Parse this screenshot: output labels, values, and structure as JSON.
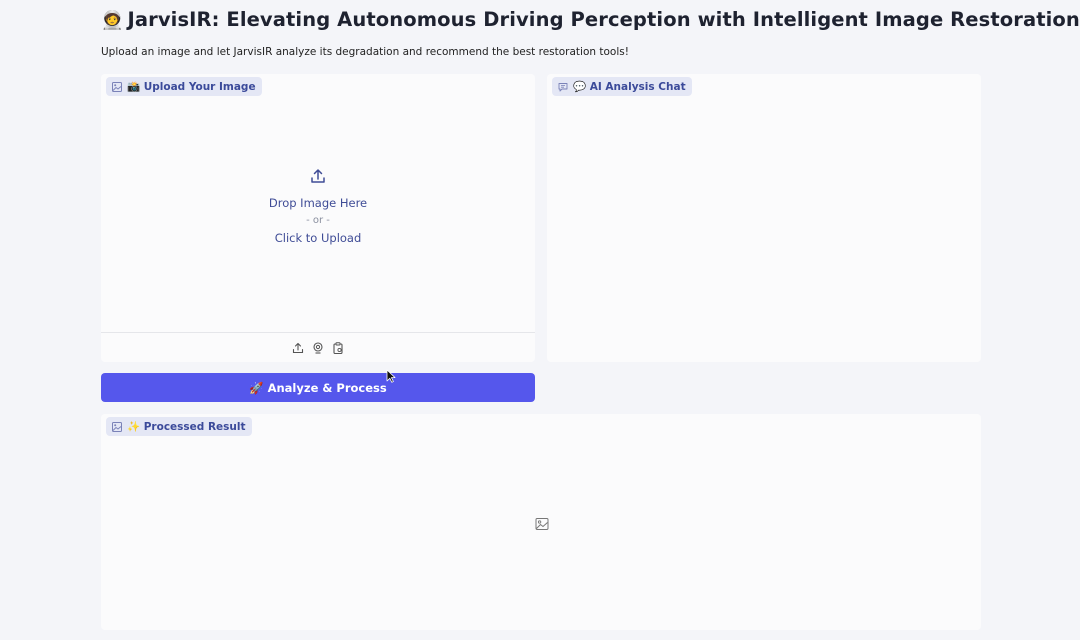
{
  "header": {
    "logo_emoji": "🧑‍🚀",
    "title": "JarvisIR: Elevating Autonomous Driving Perception with Intelligent Image Restoration",
    "subtitle": "Upload an image and let JarvisIR analyze its degradation and recommend the best restoration tools!"
  },
  "upload": {
    "label": "📸 Upload Your Image",
    "drop_text": "Drop Image Here",
    "or_text": "- or -",
    "click_text": "Click to Upload",
    "tools": [
      "upload-icon",
      "webcam-icon",
      "clipboard-icon"
    ]
  },
  "chat": {
    "label": "💬 AI Analysis Chat"
  },
  "actions": {
    "analyze_label": "🚀 Analyze & Process"
  },
  "result": {
    "label": "✨ Processed Result"
  },
  "colors": {
    "accent": "#5557ec",
    "chip_bg": "#e4e7f5",
    "chip_text": "#3b4a9a",
    "page_bg": "#f4f5f9"
  }
}
